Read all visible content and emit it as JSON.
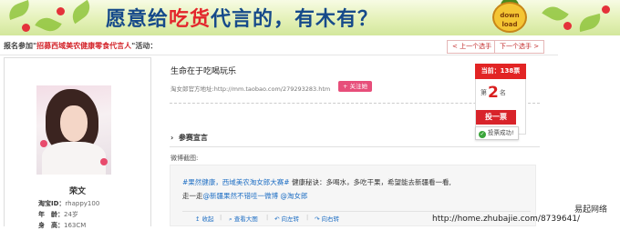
{
  "banner": {
    "slogan_pre": "愿意给",
    "slogan_hi": "吃货",
    "slogan_post": "代言的，有木有？",
    "badge_text": "down load"
  },
  "header": {
    "prefix": "报名参加\"",
    "event_name": "招募西域美农健康零食代言人",
    "suffix": "\"活动：",
    "prev_label": "< 上一个选手",
    "next_label": "下一个选手 >"
  },
  "profile": {
    "name": "荣文",
    "taobao_id_label": "淘宝ID：",
    "taobao_id": "rhappy100",
    "age_label": "年　龄：",
    "age": "24岁",
    "height_label": "身　高：",
    "height": "163CM"
  },
  "entry": {
    "title": "生命在于吃喝玩乐",
    "shop_label": "淘女郎官方地址:",
    "shop_url": "http://mm.taobao.com/279293283.htm",
    "follow_label": "+ 关注她"
  },
  "vote": {
    "current_label": "当前：138票",
    "rank_pre": "第",
    "rank": "2",
    "rank_post": "名",
    "vote_button": "投一票",
    "success_msg": "投票成功!"
  },
  "section": {
    "title": "参赛宣言",
    "weibo_label": "微博截图:"
  },
  "weibo": {
    "tag": "#果然健康，西域美农淘女郎大赛#",
    "text1": " 健康秘诀：多喝水，多吃干果，希望能去新疆看一看,",
    "text2_pre": "走一走",
    "mention1": "@新疆果然不错哇一微博",
    "mention2": " @淘女郎",
    "actions": [
      "收起",
      "查看大图",
      "向左转",
      "向右转"
    ]
  },
  "watermark": {
    "line1": "易起网络",
    "line2": "http://home.zhubajie.com/8739641/"
  }
}
